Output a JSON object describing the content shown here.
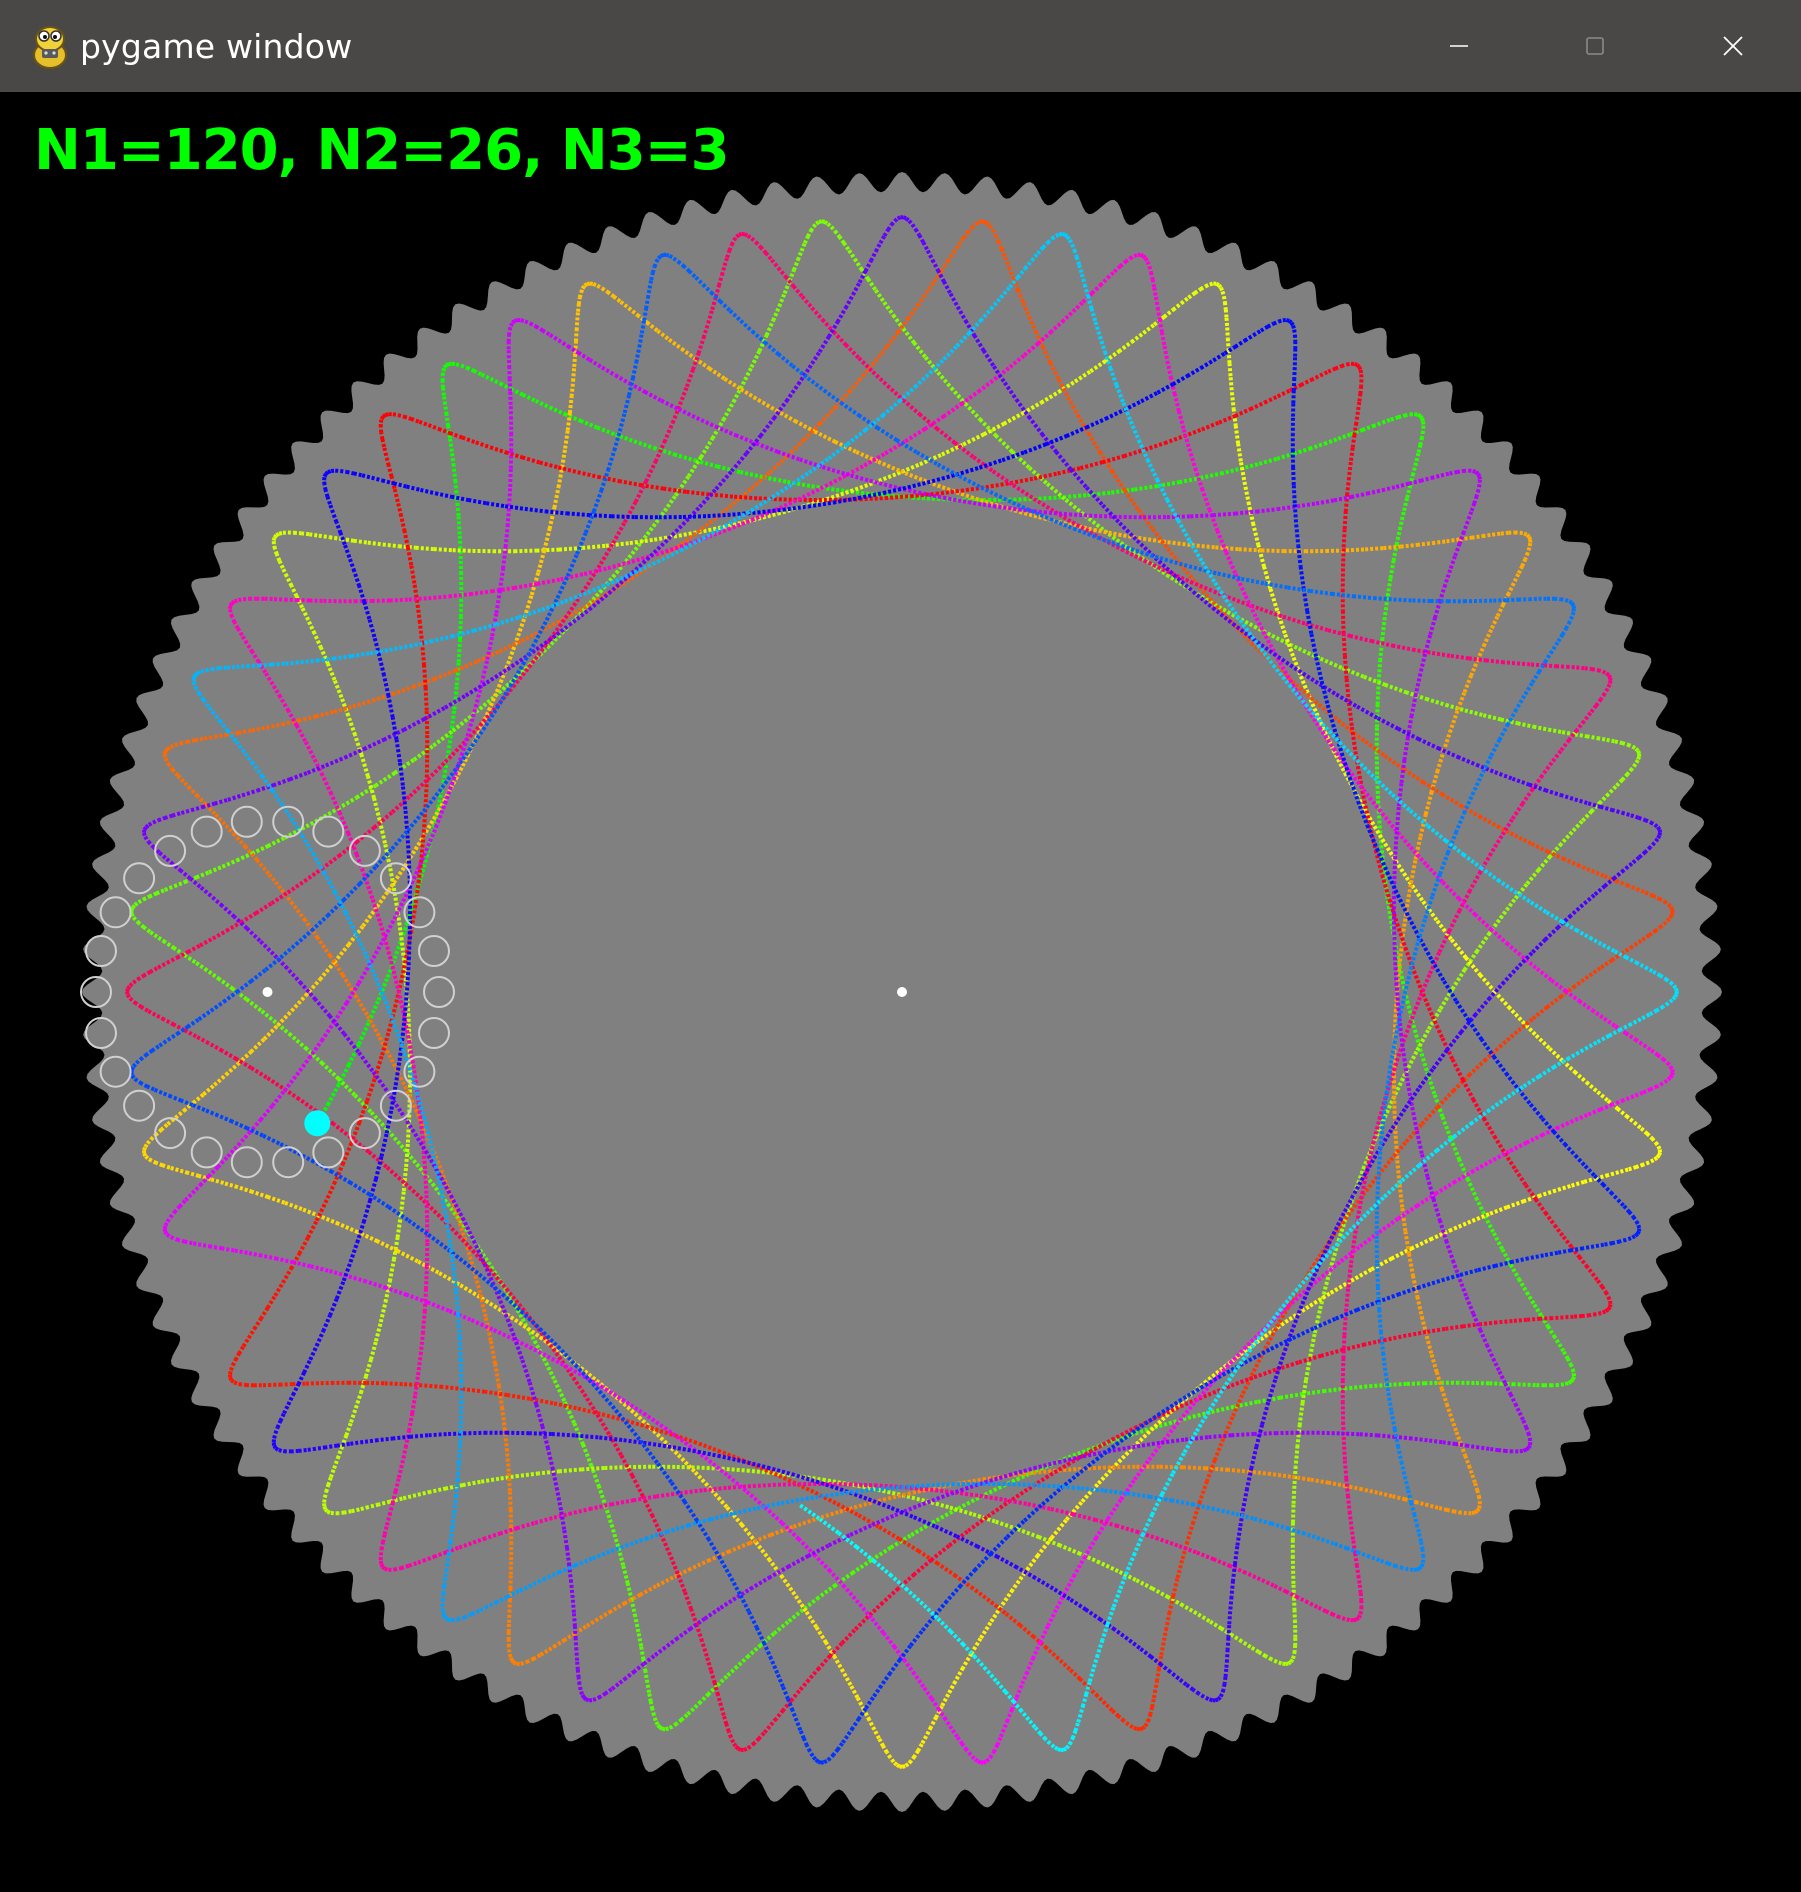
{
  "window": {
    "title": "pygame window",
    "app_icon": "pygame-snake-icon",
    "controls": {
      "minimize_icon": "minimize-icon",
      "maximize_icon": "maximize-icon",
      "close_icon": "close-icon"
    }
  },
  "hud": {
    "label": "N1=120, N2=26, N3=3"
  },
  "spirograph": {
    "N1": 120,
    "N2": 26,
    "N3": 3,
    "colors": {
      "background": "#000000",
      "ring": "#808080",
      "gear_outline": "#d0d0d0",
      "pivot": "#ffffff",
      "hud_text": "#00ff00"
    }
  }
}
